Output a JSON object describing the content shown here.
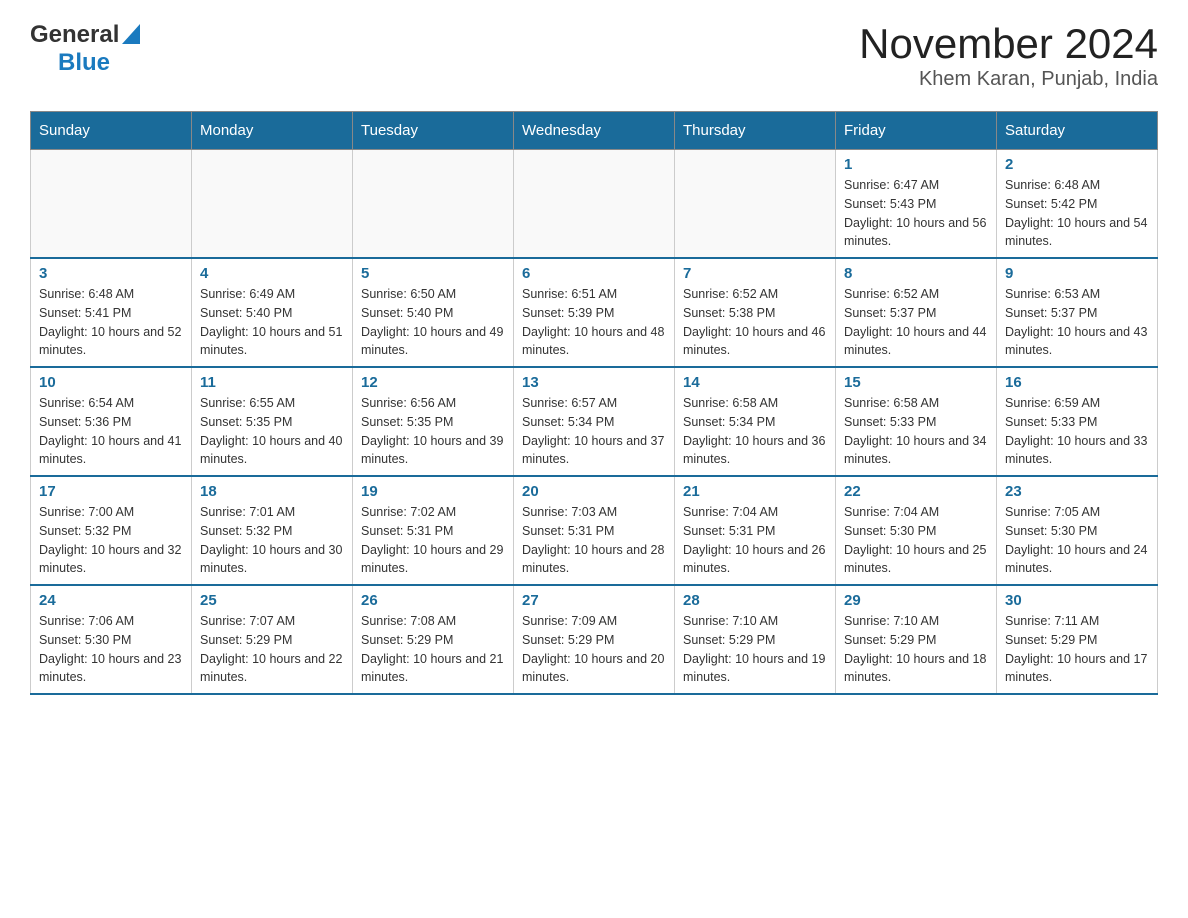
{
  "header": {
    "logo_general": "General",
    "logo_blue": "Blue",
    "title": "November 2024",
    "subtitle": "Khem Karan, Punjab, India"
  },
  "weekdays": [
    "Sunday",
    "Monday",
    "Tuesday",
    "Wednesday",
    "Thursday",
    "Friday",
    "Saturday"
  ],
  "weeks": [
    [
      {
        "day": "",
        "info": ""
      },
      {
        "day": "",
        "info": ""
      },
      {
        "day": "",
        "info": ""
      },
      {
        "day": "",
        "info": ""
      },
      {
        "day": "",
        "info": ""
      },
      {
        "day": "1",
        "info": "Sunrise: 6:47 AM\nSunset: 5:43 PM\nDaylight: 10 hours and 56 minutes."
      },
      {
        "day": "2",
        "info": "Sunrise: 6:48 AM\nSunset: 5:42 PM\nDaylight: 10 hours and 54 minutes."
      }
    ],
    [
      {
        "day": "3",
        "info": "Sunrise: 6:48 AM\nSunset: 5:41 PM\nDaylight: 10 hours and 52 minutes."
      },
      {
        "day": "4",
        "info": "Sunrise: 6:49 AM\nSunset: 5:40 PM\nDaylight: 10 hours and 51 minutes."
      },
      {
        "day": "5",
        "info": "Sunrise: 6:50 AM\nSunset: 5:40 PM\nDaylight: 10 hours and 49 minutes."
      },
      {
        "day": "6",
        "info": "Sunrise: 6:51 AM\nSunset: 5:39 PM\nDaylight: 10 hours and 48 minutes."
      },
      {
        "day": "7",
        "info": "Sunrise: 6:52 AM\nSunset: 5:38 PM\nDaylight: 10 hours and 46 minutes."
      },
      {
        "day": "8",
        "info": "Sunrise: 6:52 AM\nSunset: 5:37 PM\nDaylight: 10 hours and 44 minutes."
      },
      {
        "day": "9",
        "info": "Sunrise: 6:53 AM\nSunset: 5:37 PM\nDaylight: 10 hours and 43 minutes."
      }
    ],
    [
      {
        "day": "10",
        "info": "Sunrise: 6:54 AM\nSunset: 5:36 PM\nDaylight: 10 hours and 41 minutes."
      },
      {
        "day": "11",
        "info": "Sunrise: 6:55 AM\nSunset: 5:35 PM\nDaylight: 10 hours and 40 minutes."
      },
      {
        "day": "12",
        "info": "Sunrise: 6:56 AM\nSunset: 5:35 PM\nDaylight: 10 hours and 39 minutes."
      },
      {
        "day": "13",
        "info": "Sunrise: 6:57 AM\nSunset: 5:34 PM\nDaylight: 10 hours and 37 minutes."
      },
      {
        "day": "14",
        "info": "Sunrise: 6:58 AM\nSunset: 5:34 PM\nDaylight: 10 hours and 36 minutes."
      },
      {
        "day": "15",
        "info": "Sunrise: 6:58 AM\nSunset: 5:33 PM\nDaylight: 10 hours and 34 minutes."
      },
      {
        "day": "16",
        "info": "Sunrise: 6:59 AM\nSunset: 5:33 PM\nDaylight: 10 hours and 33 minutes."
      }
    ],
    [
      {
        "day": "17",
        "info": "Sunrise: 7:00 AM\nSunset: 5:32 PM\nDaylight: 10 hours and 32 minutes."
      },
      {
        "day": "18",
        "info": "Sunrise: 7:01 AM\nSunset: 5:32 PM\nDaylight: 10 hours and 30 minutes."
      },
      {
        "day": "19",
        "info": "Sunrise: 7:02 AM\nSunset: 5:31 PM\nDaylight: 10 hours and 29 minutes."
      },
      {
        "day": "20",
        "info": "Sunrise: 7:03 AM\nSunset: 5:31 PM\nDaylight: 10 hours and 28 minutes."
      },
      {
        "day": "21",
        "info": "Sunrise: 7:04 AM\nSunset: 5:31 PM\nDaylight: 10 hours and 26 minutes."
      },
      {
        "day": "22",
        "info": "Sunrise: 7:04 AM\nSunset: 5:30 PM\nDaylight: 10 hours and 25 minutes."
      },
      {
        "day": "23",
        "info": "Sunrise: 7:05 AM\nSunset: 5:30 PM\nDaylight: 10 hours and 24 minutes."
      }
    ],
    [
      {
        "day": "24",
        "info": "Sunrise: 7:06 AM\nSunset: 5:30 PM\nDaylight: 10 hours and 23 minutes."
      },
      {
        "day": "25",
        "info": "Sunrise: 7:07 AM\nSunset: 5:29 PM\nDaylight: 10 hours and 22 minutes."
      },
      {
        "day": "26",
        "info": "Sunrise: 7:08 AM\nSunset: 5:29 PM\nDaylight: 10 hours and 21 minutes."
      },
      {
        "day": "27",
        "info": "Sunrise: 7:09 AM\nSunset: 5:29 PM\nDaylight: 10 hours and 20 minutes."
      },
      {
        "day": "28",
        "info": "Sunrise: 7:10 AM\nSunset: 5:29 PM\nDaylight: 10 hours and 19 minutes."
      },
      {
        "day": "29",
        "info": "Sunrise: 7:10 AM\nSunset: 5:29 PM\nDaylight: 10 hours and 18 minutes."
      },
      {
        "day": "30",
        "info": "Sunrise: 7:11 AM\nSunset: 5:29 PM\nDaylight: 10 hours and 17 minutes."
      }
    ]
  ]
}
